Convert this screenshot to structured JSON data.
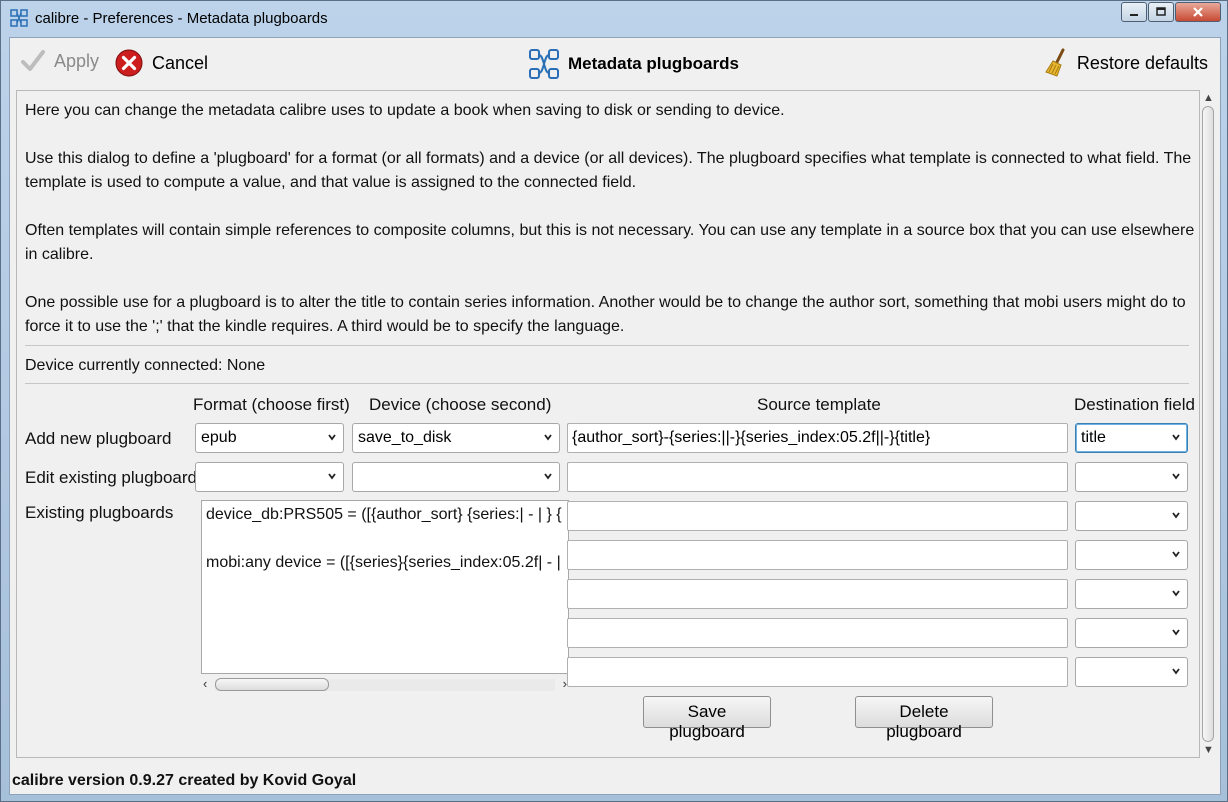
{
  "window": {
    "title": "calibre - Preferences - Metadata plugboards"
  },
  "toolbar": {
    "apply_label": "Apply",
    "cancel_label": "Cancel",
    "page_title": "Metadata plugboards",
    "restore_label": "Restore defaults"
  },
  "description": {
    "p1": "Here you can change the metadata calibre uses to update a book when saving to disk or sending to device.",
    "p2": "Use this dialog to define a 'plugboard' for a format (or all formats) and a device (or all devices). The plugboard specifies what template is connected to what field. The template is used to compute a value, and that value is assigned to the connected field.",
    "p3": "Often templates will contain simple references to composite columns, but this is not necessary. You can use any template in a source box that you can use elsewhere in calibre.",
    "p4": "One possible use for a plugboard is to alter the title to contain series information. Another would be to change the author sort, something that mobi users might do to force it to use the ';' that the kindle requires. A third would be to specify the language."
  },
  "device_status": "Device currently connected: None",
  "columns": {
    "format": "Format (choose first)",
    "device": "Device (choose second)",
    "source": "Source template",
    "destination": "Destination field"
  },
  "rows": {
    "add_new": "Add new plugboard",
    "edit_existing": "Edit existing plugboard",
    "existing": "Existing plugboards"
  },
  "add_new": {
    "format_value": "epub",
    "device_value": "save_to_disk",
    "template_value": "{author_sort}-{series:||-}{series_index:05.2f||-}{title}",
    "destination_value": "title"
  },
  "existing_plugboards": [
    "device_db:PRS505 = ([{author_sort} {series:| - | } {",
    "mobi:any device = ([{series}{series_index:05.2f| - |"
  ],
  "buttons": {
    "save": "Save plugboard",
    "delete": "Delete plugboard"
  },
  "status_bar": "calibre version 0.9.27 created by Kovid Goyal"
}
